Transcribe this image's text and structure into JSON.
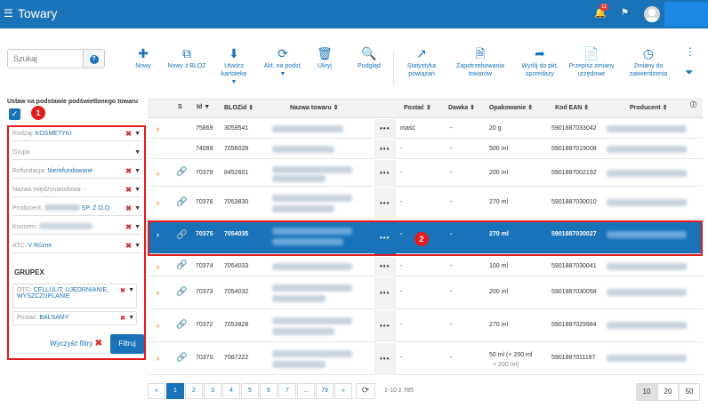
{
  "app": {
    "title": "Towary",
    "menu_icon": "hamburger-icon",
    "notif_count": "11"
  },
  "toolbar": {
    "search_placeholder": "Szukaj",
    "buttons": [
      {
        "label": "Nowy",
        "icon": "plus-icon"
      },
      {
        "label": "Nowy z BLOZ",
        "icon": "copy-icon"
      },
      {
        "label": "Utwórz kartotekę",
        "icon": "download-icon"
      },
      {
        "label": "Akt. na podst.",
        "icon": "refresh-icon"
      },
      {
        "label": "Ukryj",
        "icon": "trash-icon"
      },
      {
        "label": "Podgląd",
        "icon": "magnifier-icon"
      },
      {
        "label": "Statystyka powiązań",
        "icon": "chart-icon"
      },
      {
        "label": "Zapotrzebowania towarów",
        "icon": "document-icon"
      },
      {
        "label": "Wyślij do pkt. sprzedaży",
        "icon": "share-icon"
      },
      {
        "label": "Przepisz zmiany urzędowe",
        "icon": "copy-doc-icon"
      },
      {
        "label": "Zmiany do zatwierdzenia",
        "icon": "clock-icon"
      }
    ]
  },
  "filters": {
    "header": "Ustaw na podstawie podświetlonego towaru",
    "fields": [
      {
        "label": "Rodzaj:",
        "value": "KOSMETYKI",
        "clearable": true
      },
      {
        "label": "Grupa",
        "value": "",
        "clearable": false
      },
      {
        "label": "Refundacja:",
        "value": "Nierefundowane",
        "clearable": true
      },
      {
        "label": "Nazwa międzynarodowa:",
        "value": "-",
        "clearable": true
      },
      {
        "label": "Producent:",
        "value": "SP. Z O.O",
        "clearable": true
      },
      {
        "label": "Koncern:",
        "value": "",
        "clearable": true
      },
      {
        "label": "ATC:",
        "value": "V Różne",
        "clearable": true
      }
    ],
    "grupex_label": "GRUPEX",
    "otc": {
      "label": "OTC:",
      "value": "CELLULIT, UJĘDRNIANIE, WYSZCZUPLANIE"
    },
    "postac": {
      "label": "Postać:",
      "value": "BALSAMY"
    },
    "clear_label": "Wyczyść filtry",
    "filter_label": "Filtruj"
  },
  "table": {
    "columns": [
      "S",
      "Id",
      "BLOZid",
      "Nazwa towaru",
      "Postać",
      "Dawka",
      "Opakowanie",
      "Kod EAN",
      "Producent"
    ],
    "rows": [
      {
        "id": "75869",
        "bloz": "3059541",
        "postac": "maść",
        "dawka": "-",
        "opak": "20 g",
        "ean": "5901887033042",
        "link": false,
        "arrow": true
      },
      {
        "id": "74099",
        "bloz": "7056028",
        "postac": "-",
        "dawka": "-",
        "opak": "500 ml",
        "ean": "5901887019008",
        "link": false,
        "arrow": false
      },
      {
        "id": "70379",
        "bloz": "8452601",
        "postac": "-",
        "dawka": "-",
        "opak": "200 ml",
        "ean": "5901887002192",
        "link": true,
        "arrow": true
      },
      {
        "id": "70376",
        "bloz": "7053830",
        "postac": "-",
        "dawka": "-",
        "opak": "270 ml",
        "ean": "5901887030010",
        "link": true,
        "arrow": true
      },
      {
        "id": "70375",
        "bloz": "7054035",
        "postac": "-",
        "dawka": "-",
        "opak": "270 ml",
        "ean": "5901887030027",
        "link": true,
        "arrow": true,
        "selected": true
      },
      {
        "id": "70374",
        "bloz": "7054033",
        "postac": "-",
        "dawka": "-",
        "opak": "100 ml",
        "ean": "5901887030041",
        "link": true,
        "arrow": true
      },
      {
        "id": "70373",
        "bloz": "7054032",
        "postac": "-",
        "dawka": "-",
        "opak": "200 ml",
        "ean": "5901887030058",
        "link": true,
        "arrow": true
      },
      {
        "id": "70372",
        "bloz": "7053828",
        "postac": "-",
        "dawka": "-",
        "opak": "270 ml",
        "ean": "5901887029984",
        "link": true,
        "arrow": true
      },
      {
        "id": "70370",
        "bloz": "7067222",
        "postac": "-",
        "dawka": "-",
        "opak": "50 ml (+ 200 ml",
        "opak2": "+ 200 ml)",
        "ean": "5901887011187",
        "link": true,
        "arrow": true
      }
    ]
  },
  "pagination": {
    "prev": "«",
    "next": "»",
    "pages": [
      "1",
      "2",
      "3",
      "4",
      "5",
      "6",
      "7",
      "...",
      "79"
    ],
    "current": "1",
    "count_text": "1-10 z 785",
    "sizes": [
      "10",
      "20",
      "50"
    ],
    "current_size": "10"
  },
  "markers": [
    "1",
    "2"
  ],
  "colors": {
    "primary": "#1a73b8",
    "accent": "#f57c00",
    "highlight": "#e31b1b"
  }
}
